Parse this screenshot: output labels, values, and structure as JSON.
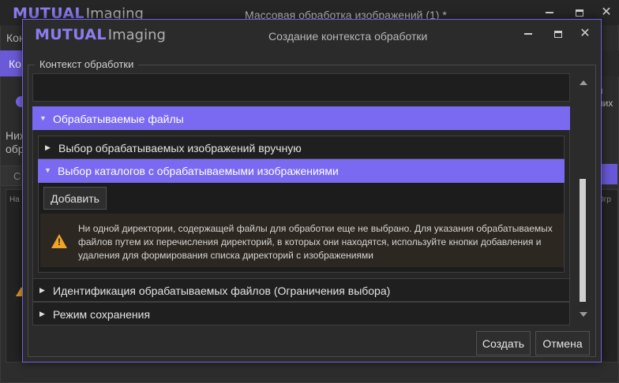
{
  "colors": {
    "accent": "#7a6af2",
    "background": "#2b2b2b",
    "warning": "#f0a42a"
  },
  "background_window": {
    "logo_bold": "MUTUAL",
    "logo_light": "Imaging",
    "title": "Массовая обработка изображений (1) *",
    "menu_partial": "Кон",
    "tab_partial": "Ко",
    "right_partial_1": "я",
    "right_partial_2": "них",
    "left_partial_1": "Ниж",
    "left_partial_2": "обра",
    "input_partial": "С",
    "grid_header_left": "На",
    "grid_header_right": "Огр"
  },
  "dialog": {
    "logo_bold": "MUTUAL",
    "logo_light": "Imaging",
    "title": "Создание контекста обработки",
    "group_label": "Контекст обработки",
    "sections": {
      "files": {
        "label": "Обрабатываемые файлы",
        "expanded": true
      },
      "manual": {
        "label": "Выбор обрабатываемых изображений вручную",
        "expanded": false
      },
      "catalogs": {
        "label": "Выбор каталогов с обрабатываемыми изображениями",
        "expanded": true
      },
      "identification": {
        "label": "Идентификация обрабатываемых файлов (Ограничения выбора)",
        "expanded": false
      },
      "save_mode": {
        "label": "Режим сохранения",
        "expanded": false
      }
    },
    "add_button": "Добавить",
    "warning_text": "Ни одной директории, содержащей файлы для обработки еще не выбрано. Для указания обрабатываемых файлов путем их перечисления директорий, в которых они находятся, используйте кнопки добавления и удаления для формирования списка директорий с изображениями",
    "create_button": "Создать",
    "cancel_button": "Отмена"
  },
  "icons": {
    "expanded": "triangle-down",
    "collapsed": "triangle-right",
    "warning": "warning-triangle"
  }
}
